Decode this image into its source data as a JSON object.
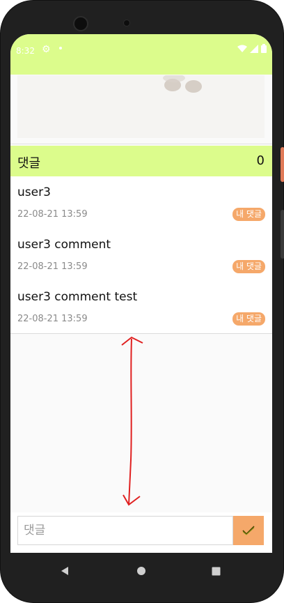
{
  "status_bar": {
    "time": "8:32",
    "icons": [
      "gear-icon",
      "dot-icon",
      "wifi-icon",
      "signal-icon",
      "battery-icon"
    ]
  },
  "colors": {
    "header_bg": "#dcfc8c",
    "accent": "#f5a86a",
    "frame": "#202020"
  },
  "comments_header": {
    "title": "댓글",
    "count": "0"
  },
  "comments": [
    {
      "text": "user3",
      "date": "22-08-21 13:59",
      "badge": "내 댓글"
    },
    {
      "text": "user3 comment",
      "date": "22-08-21 13:59",
      "badge": "내 댓글"
    },
    {
      "text": "user3 comment test",
      "date": "22-08-21 13:59",
      "badge": "내 댓글"
    }
  ],
  "input": {
    "placeholder": "댓글",
    "submit_icon": "check-icon"
  },
  "nav": {
    "icons": [
      "back-icon",
      "home-icon",
      "recents-icon"
    ]
  }
}
